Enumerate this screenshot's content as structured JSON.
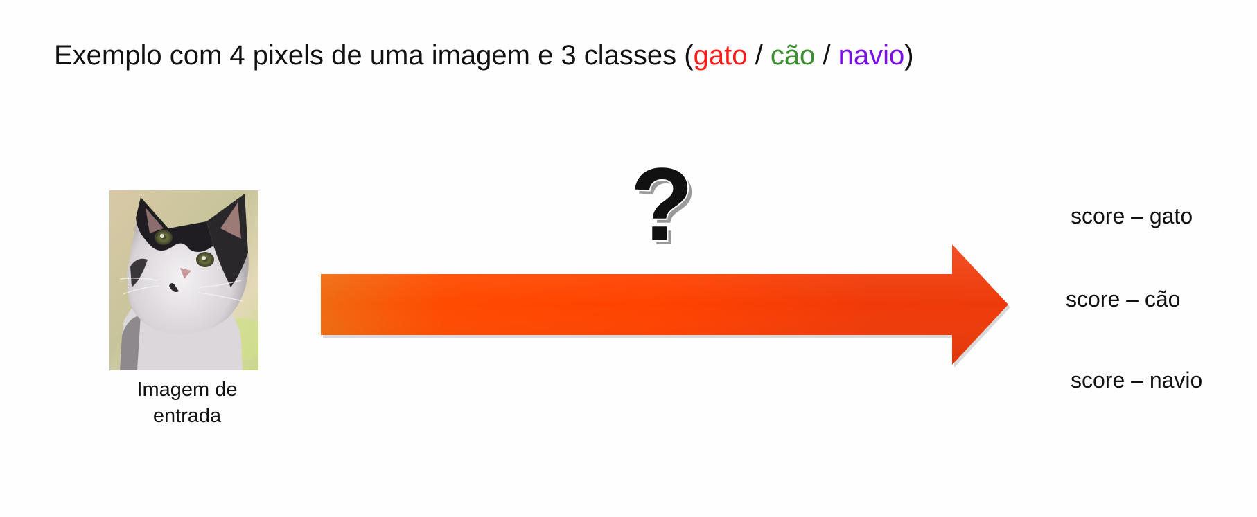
{
  "title": {
    "prefix": "Exemplo com 4 pixels de uma imagem e 3 classes (",
    "class1": "gato",
    "sep1": " / ",
    "class2": "cão",
    "sep2": " / ",
    "class3": "navio",
    "suffix": ")"
  },
  "colors": {
    "gato": "#ff1a1a",
    "cao": "#3a8f2e",
    "navio": "#7a0ee6",
    "arrow": "#ff4500"
  },
  "image": {
    "icon": "cat-photo",
    "caption_line1": "Imagem de",
    "caption_line2": "entrada"
  },
  "arrow": {
    "icon": "right-arrow",
    "label": "?"
  },
  "scores": {
    "gato": "score – gato",
    "cao": "score – cão",
    "navio": "score – navio"
  }
}
